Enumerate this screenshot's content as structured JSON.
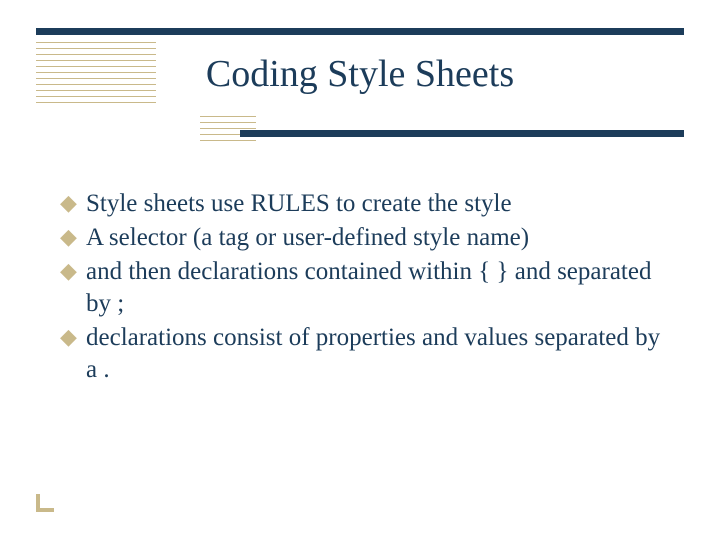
{
  "title": "Coding Style Sheets",
  "bullets": {
    "b0": "Style sheets use RULES to create the style",
    "b1": "A selector (a tag or user-defined style name)",
    "b2": "and then declarations contained within { } and separated by ;",
    "b3": "declarations consist of properties and values separated by a ."
  }
}
